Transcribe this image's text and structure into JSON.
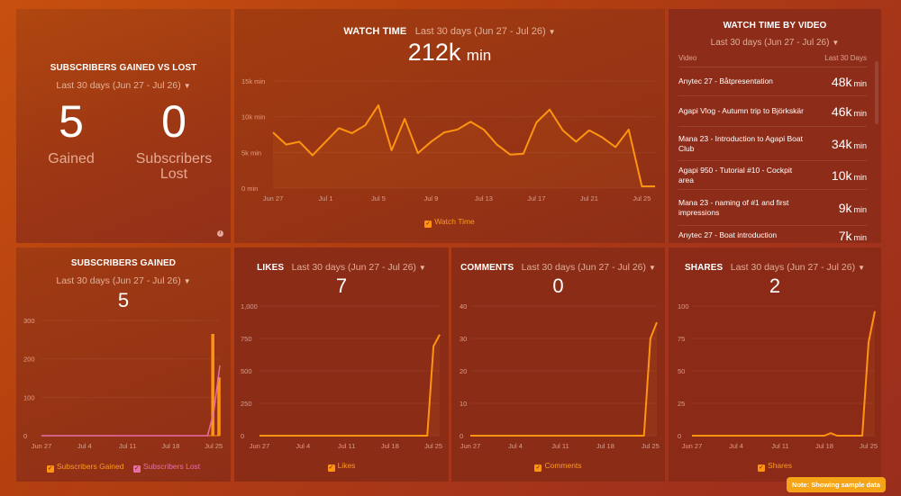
{
  "date_range": "Last 30 days (Jun 27 - Jul 26)",
  "colors": {
    "accent": "#ff9410",
    "pink": "#e76fa5",
    "note_bg": "#f5a417"
  },
  "subs_gained_vs_lost": {
    "title": "SUBSCRIBERS GAINED VS LOST",
    "gained_value": "5",
    "gained_label": "Gained",
    "lost_value": "0",
    "lost_label_1": "Subscribers",
    "lost_label_2": "Lost",
    "info_icon": "info-icon"
  },
  "watch_time": {
    "title": "WATCH TIME",
    "value": "212k",
    "unit": "min",
    "legend": "Watch Time"
  },
  "watch_time_by_video": {
    "title": "WATCH TIME BY VIDEO",
    "col_video": "Video",
    "col_period": "Last 30 Days",
    "rows": [
      {
        "name": "Anytec 27 - Båtpresentation",
        "value": "48k",
        "unit": "min"
      },
      {
        "name": "Agapi Vlog - Autumn trip to Björkskär",
        "value": "46k",
        "unit": "min"
      },
      {
        "name": "Mana 23 - Introduction to Agapi Boat Club",
        "value": "34k",
        "unit": "min"
      },
      {
        "name": "Agapi 950 - Tutorial #10 - Cockpit area",
        "value": "10k",
        "unit": "min"
      },
      {
        "name": "Mana 23 - naming of #1 and first impressions",
        "value": "9k",
        "unit": "min"
      },
      {
        "name": "Anytec 27 - Boat introduction",
        "value": "7k",
        "unit": "min"
      }
    ]
  },
  "subs_gained": {
    "title": "SUBSCRIBERS GAINED",
    "value": "5",
    "legend_gained": "Subscribers Gained",
    "legend_lost": "Subscribers Lost"
  },
  "likes": {
    "title": "LIKES",
    "value": "7",
    "legend": "Likes"
  },
  "comments": {
    "title": "COMMENTS",
    "value": "0",
    "legend": "Comments"
  },
  "shares": {
    "title": "SHARES",
    "value": "2",
    "legend": "Shares"
  },
  "note": "Note: Showing sample data",
  "chart_data": [
    {
      "id": "watch_time",
      "type": "line",
      "title": "WATCH TIME",
      "x": [
        "Jun 27",
        "Jun 28",
        "Jun 29",
        "Jun 30",
        "Jul 1",
        "Jul 2",
        "Jul 3",
        "Jul 4",
        "Jul 5",
        "Jul 6",
        "Jul 7",
        "Jul 8",
        "Jul 9",
        "Jul 10",
        "Jul 11",
        "Jul 12",
        "Jul 13",
        "Jul 14",
        "Jul 15",
        "Jul 16",
        "Jul 17",
        "Jul 18",
        "Jul 19",
        "Jul 20",
        "Jul 21",
        "Jul 22",
        "Jul 23",
        "Jul 24",
        "Jul 25",
        "Jul 26"
      ],
      "xticks": [
        "Jun 27",
        "Jul 1",
        "Jul 5",
        "Jul 9",
        "Jul 13",
        "Jul 17",
        "Jul 21",
        "Jul 25"
      ],
      "series": [
        {
          "name": "Watch Time",
          "values": [
            7800,
            6100,
            6500,
            4600,
            6500,
            8400,
            7700,
            8800,
            11600,
            5300,
            9700,
            4900,
            6500,
            7800,
            8200,
            9300,
            8200,
            6100,
            4700,
            4800,
            9200,
            11000,
            8100,
            6500,
            8100,
            7100,
            5750,
            8200,
            250,
            250
          ]
        }
      ],
      "yticks": [
        "0 min",
        "5k min",
        "10k min",
        "15k min"
      ],
      "ylim": [
        0,
        15000
      ],
      "legend": "bottom"
    },
    {
      "id": "subs_gained",
      "type": "bar",
      "title": "SUBSCRIBERS GAINED",
      "x": [
        "Jun 27",
        "Jun 28",
        "Jun 29",
        "Jun 30",
        "Jul 1",
        "Jul 2",
        "Jul 3",
        "Jul 4",
        "Jul 5",
        "Jul 6",
        "Jul 7",
        "Jul 8",
        "Jul 9",
        "Jul 10",
        "Jul 11",
        "Jul 12",
        "Jul 13",
        "Jul 14",
        "Jul 15",
        "Jul 16",
        "Jul 17",
        "Jul 18",
        "Jul 19",
        "Jul 20",
        "Jul 21",
        "Jul 22",
        "Jul 23",
        "Jul 24",
        "Jul 25",
        "Jul 26"
      ],
      "xticks": [
        "Jun 27",
        "Jul 4",
        "Jul 11",
        "Jul 18",
        "Jul 25"
      ],
      "series": [
        {
          "name": "Subscribers Gained",
          "kind": "bar",
          "values": [
            0,
            0,
            0,
            0,
            0,
            0,
            0,
            0,
            0,
            0,
            0,
            0,
            0,
            0,
            0,
            0,
            0,
            0,
            0,
            0,
            0,
            0,
            0,
            0,
            0,
            0,
            0,
            0,
            265,
            152
          ]
        },
        {
          "name": "Subscribers Lost",
          "kind": "line",
          "values": [
            0,
            0,
            0,
            0,
            0,
            0,
            0,
            0,
            0,
            0,
            0,
            0,
            0,
            0,
            0,
            0,
            0,
            0,
            0,
            0,
            0,
            0,
            0,
            0,
            0,
            0,
            0,
            0,
            60,
            183
          ]
        }
      ],
      "yticks": [
        "0",
        "100",
        "200",
        "300"
      ],
      "ylim": [
        0,
        300
      ],
      "legend": "bottom"
    },
    {
      "id": "likes",
      "type": "line",
      "title": "LIKES",
      "x": [
        "Jun 27",
        "Jun 28",
        "Jun 29",
        "Jun 30",
        "Jul 1",
        "Jul 2",
        "Jul 3",
        "Jul 4",
        "Jul 5",
        "Jul 6",
        "Jul 7",
        "Jul 8",
        "Jul 9",
        "Jul 10",
        "Jul 11",
        "Jul 12",
        "Jul 13",
        "Jul 14",
        "Jul 15",
        "Jul 16",
        "Jul 17",
        "Jul 18",
        "Jul 19",
        "Jul 20",
        "Jul 21",
        "Jul 22",
        "Jul 23",
        "Jul 24",
        "Jul 25",
        "Jul 26"
      ],
      "xticks": [
        "Jun 27",
        "Jul 4",
        "Jul 11",
        "Jul 18",
        "Jul 25"
      ],
      "series": [
        {
          "name": "Likes",
          "values": [
            0,
            0,
            0,
            0,
            0,
            0,
            0,
            0,
            0,
            0,
            0,
            0,
            0,
            0,
            0,
            0,
            0,
            0,
            0,
            0,
            0,
            0,
            0,
            0,
            0,
            0,
            0,
            0,
            690,
            780
          ]
        }
      ],
      "yticks": [
        "0",
        "250",
        "500",
        "750",
        "1,000"
      ],
      "ylim": [
        0,
        1000
      ],
      "legend": "bottom"
    },
    {
      "id": "comments",
      "type": "line",
      "title": "COMMENTS",
      "x": [
        "Jun 27",
        "Jun 28",
        "Jun 29",
        "Jun 30",
        "Jul 1",
        "Jul 2",
        "Jul 3",
        "Jul 4",
        "Jul 5",
        "Jul 6",
        "Jul 7",
        "Jul 8",
        "Jul 9",
        "Jul 10",
        "Jul 11",
        "Jul 12",
        "Jul 13",
        "Jul 14",
        "Jul 15",
        "Jul 16",
        "Jul 17",
        "Jul 18",
        "Jul 19",
        "Jul 20",
        "Jul 21",
        "Jul 22",
        "Jul 23",
        "Jul 24",
        "Jul 25",
        "Jul 26"
      ],
      "xticks": [
        "Jun 27",
        "Jul 4",
        "Jul 11",
        "Jul 18",
        "Jul 25"
      ],
      "series": [
        {
          "name": "Comments",
          "values": [
            0,
            0,
            0,
            0,
            0,
            0,
            0,
            0,
            0,
            0,
            0,
            0,
            0,
            0,
            0,
            0,
            0,
            0,
            0,
            0,
            0,
            0,
            0,
            0,
            0,
            0,
            0,
            0,
            30,
            35
          ]
        }
      ],
      "yticks": [
        "0",
        "10",
        "20",
        "30",
        "40"
      ],
      "ylim": [
        0,
        40
      ],
      "legend": "bottom"
    },
    {
      "id": "shares",
      "type": "line",
      "title": "SHARES",
      "x": [
        "Jun 27",
        "Jun 28",
        "Jun 29",
        "Jun 30",
        "Jul 1",
        "Jul 2",
        "Jul 3",
        "Jul 4",
        "Jul 5",
        "Jul 6",
        "Jul 7",
        "Jul 8",
        "Jul 9",
        "Jul 10",
        "Jul 11",
        "Jul 12",
        "Jul 13",
        "Jul 14",
        "Jul 15",
        "Jul 16",
        "Jul 17",
        "Jul 18",
        "Jul 19",
        "Jul 20",
        "Jul 21",
        "Jul 22",
        "Jul 23",
        "Jul 24",
        "Jul 25",
        "Jul 26"
      ],
      "xticks": [
        "Jun 27",
        "Jul 4",
        "Jul 11",
        "Jul 18",
        "Jul 25"
      ],
      "series": [
        {
          "name": "Shares",
          "values": [
            0,
            0,
            0,
            0,
            0,
            0,
            0,
            0,
            0,
            0,
            0,
            0,
            0,
            0,
            0,
            0,
            0,
            0,
            0,
            0,
            0,
            0,
            2,
            0,
            0,
            0,
            0,
            0,
            72,
            96
          ]
        }
      ],
      "yticks": [
        "0",
        "25",
        "50",
        "75",
        "100"
      ],
      "ylim": [
        0,
        100
      ],
      "legend": "bottom"
    }
  ]
}
